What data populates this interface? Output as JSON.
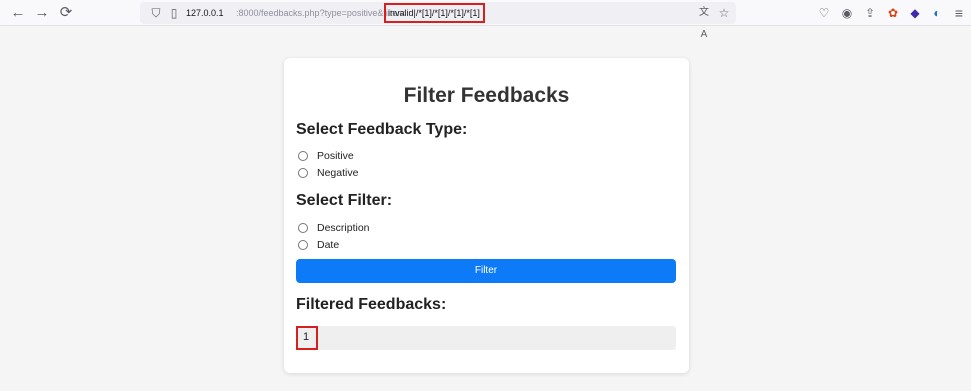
{
  "browser": {
    "back_icon": "←",
    "forward_icon": "→",
    "reload_icon": "⟳",
    "shield_icon": "⛉",
    "page_icon": "▯",
    "url_host": "127.0.0.1",
    "url_path": ":8000/feedbacks.php?type=positive&filter=",
    "url_injection": "invalid|/*[1]/*[1]/*[1]/*[1]",
    "translate_icon": "文A",
    "bookmark_icon": "☆",
    "pocket_icon": "♡",
    "account_icon": "◉",
    "share_icon": "⇪",
    "ext1_icon": "✿",
    "ext2_icon": "◆",
    "ext3_icon": "◐",
    "menu_icon": "≡"
  },
  "page": {
    "title": "Filter Feedbacks",
    "type_heading": "Select Feedback Type:",
    "type_options": [
      "Positive",
      "Negative"
    ],
    "filter_heading": "Select Filter:",
    "filter_options": [
      "Description",
      "Date"
    ],
    "filter_button": "Filter",
    "results_heading": "Filtered Feedbacks:",
    "result_value": "1"
  },
  "colors": {
    "accent": "#0d7bf7",
    "highlight": "#d62020"
  }
}
